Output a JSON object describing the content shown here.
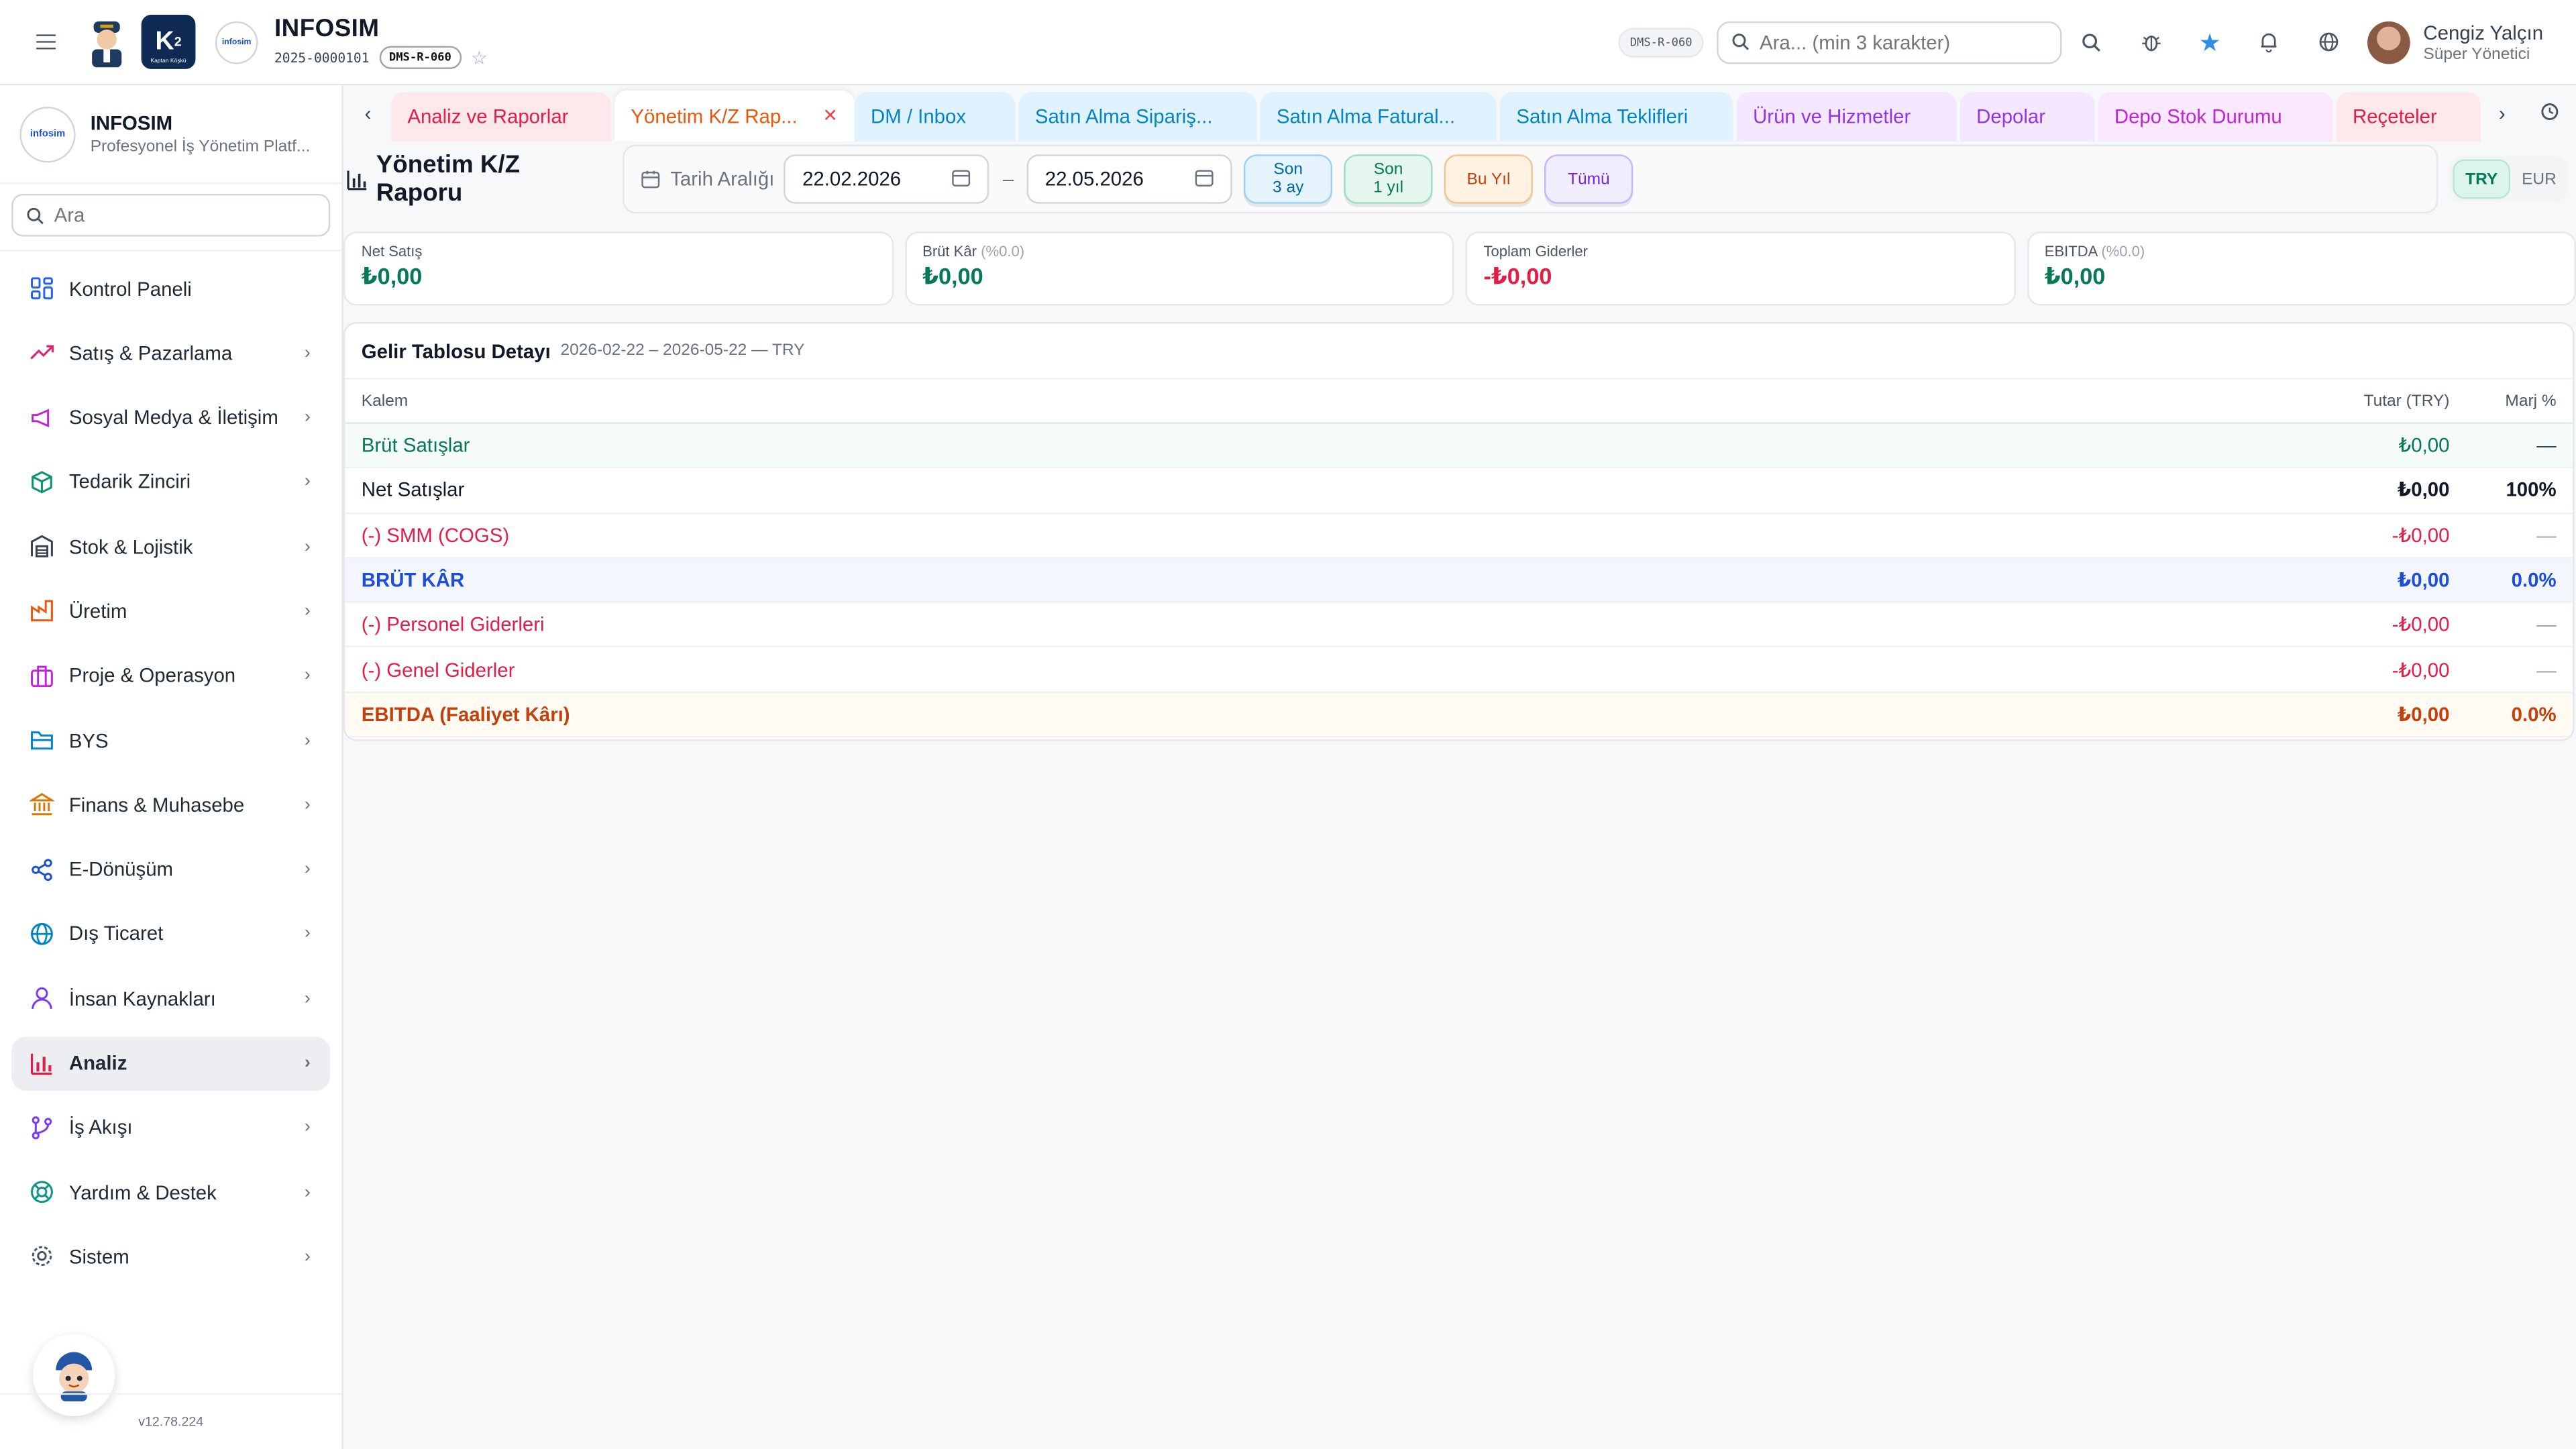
{
  "header": {
    "company_name": "INFOSIM",
    "company_code": "2025-0000101",
    "screen_code": "DMS-R-060",
    "screen_code_badge": "DMS-R-060",
    "k2_text": "K",
    "k2_sup": "2",
    "k2_sub": "Kaptan Köşkü",
    "logo_text": "infosim",
    "search_placeholder": "Ara... (min 3 karakter)",
    "user_name": "Cengiz Yalçın",
    "user_role": "Süper Yönetici"
  },
  "sidebar": {
    "title": "INFOSIM",
    "subtitle": "Profesyonel İş Yönetim Platf...",
    "search_placeholder": "Ara",
    "version": "v12.78.224",
    "items": [
      {
        "label": "Kontrol Paneli",
        "icon": "dashboard-icon",
        "color": "#2563eb"
      },
      {
        "label": "Satış & Pazarlama",
        "icon": "trending-up-icon",
        "color": "#db2777"
      },
      {
        "label": "Sosyal Medya & İletişim",
        "icon": "megaphone-icon",
        "color": "#c026d3"
      },
      {
        "label": "Tedarik Zinciri",
        "icon": "package-icon",
        "color": "#059669"
      },
      {
        "label": "Stok & Lojistik",
        "icon": "warehouse-icon",
        "color": "#374151"
      },
      {
        "label": "Üretim",
        "icon": "factory-icon",
        "color": "#ea580c"
      },
      {
        "label": "Proje & Operasyon",
        "icon": "briefcase-icon",
        "color": "#c026d3"
      },
      {
        "label": "BYS",
        "icon": "folder-icon",
        "color": "#0284c7"
      },
      {
        "label": "Finans & Muhasebe",
        "icon": "bank-icon",
        "color": "#d97706"
      },
      {
        "label": "E-Dönüşüm",
        "icon": "share-icon",
        "color": "#1d4ed8"
      },
      {
        "label": "Dış Ticaret",
        "icon": "globe-icon",
        "color": "#0284c7"
      },
      {
        "label": "İnsan Kaynakları",
        "icon": "user-icon",
        "color": "#7c3aed"
      },
      {
        "label": "Analiz",
        "icon": "bar-chart-icon",
        "color": "#e11d48"
      },
      {
        "label": "İş Akışı",
        "icon": "git-branch-icon",
        "color": "#7c3aed"
      },
      {
        "label": "Yardım & Destek",
        "icon": "lifebuoy-icon",
        "color": "#0d9488"
      },
      {
        "label": "Sistem",
        "icon": "gear-icon",
        "color": "#4b5563"
      }
    ]
  },
  "tabs": [
    {
      "label": "Analiz ve Raporlar",
      "bg": "#fde8ec",
      "color": "#e11d48"
    },
    {
      "label": "Yönetim K/Z Rap...",
      "bg": "#ffffff",
      "color": "#ea580c"
    },
    {
      "label": "DM / Inbox",
      "bg": "#e0f2fe",
      "color": "#0284c7"
    },
    {
      "label": "Satın Alma Sipariş...",
      "bg": "#e0f2fe",
      "color": "#0284c7"
    },
    {
      "label": "Satın Alma Fatural...",
      "bg": "#e0f2fe",
      "color": "#0284c7"
    },
    {
      "label": "Satın Alma Teklifleri",
      "bg": "#e0f2fe",
      "color": "#0284c7"
    },
    {
      "label": "Ürün ve Hizmetler",
      "bg": "#f3e8ff",
      "color": "#9333ea"
    },
    {
      "label": "Depolar",
      "bg": "#f3e8ff",
      "color": "#9333ea"
    },
    {
      "label": "Depo Stok Durumu",
      "bg": "#fae8ff",
      "color": "#c026d3"
    },
    {
      "label": "Reçeteler",
      "bg": "#fde8ec",
      "color": "#e11d48"
    }
  ],
  "page": {
    "title": "Yönetim K/Z Raporu",
    "date_range_label": "Tarih Aralığı",
    "date_from": "22.02.2026",
    "date_sep": "–",
    "date_to": "22.05.2026",
    "quick": [
      {
        "label": "Son\n3 ay"
      },
      {
        "label": "Son\n1 yıl"
      },
      {
        "label": "Bu Yıl"
      },
      {
        "label": "Tümü"
      }
    ],
    "currency": {
      "on": "TRY",
      "off": "EUR"
    }
  },
  "kpis": [
    {
      "label": "Net Satış",
      "suffix": "",
      "value": "₺0,00",
      "color": "#047857"
    },
    {
      "label": "Brüt Kâr",
      "suffix": "(%0.0)",
      "value": "₺0,00",
      "color": "#047857"
    },
    {
      "label": "Toplam Giderler",
      "suffix": "",
      "value": "-₺0,00",
      "color": "#e11d48"
    },
    {
      "label": "EBITDA",
      "suffix": "(%0.0)",
      "value": "₺0,00",
      "color": "#047857"
    }
  ],
  "income": {
    "title": "Gelir Tablosu Detayı",
    "subtitle": "2026-02-22 – 2026-05-22 — TRY",
    "col_item": "Kalem",
    "col_amount": "Tutar (TRY)",
    "col_margin": "Marj %",
    "rows": [
      {
        "item": "Brüt Satışlar",
        "amount": "₺0,00",
        "margin": "—",
        "color": "#047857",
        "bold": false,
        "bg": "#f4fbf8",
        "amount_color": "#047857",
        "margin_color": "#374151"
      },
      {
        "item": "Net Satışlar",
        "amount": "₺0,00",
        "margin": "100%",
        "color": "#111827",
        "bold": false,
        "bg": "#ffffff",
        "amount_color": "#111827",
        "margin_color": "#111827"
      },
      {
        "item": "(-) SMM (COGS)",
        "amount": "-₺0,00",
        "margin": "—",
        "color": "#e11d48",
        "bold": false,
        "bg": "#ffffff",
        "amount_color": "#e11d48",
        "margin_color": "#9ca3af"
      },
      {
        "item": "BRÜT KÂR",
        "amount": "₺0,00",
        "margin": "0.0%",
        "color": "#1d4ed8",
        "bold": true,
        "bg": "#f3f7fd",
        "amount_color": "#1d4ed8",
        "margin_color": "#1d4ed8"
      },
      {
        "item": "(-) Personel Giderleri",
        "amount": "-₺0,00",
        "margin": "—",
        "color": "#e11d48",
        "bold": false,
        "bg": "#ffffff",
        "amount_color": "#e11d48",
        "margin_color": "#9ca3af"
      },
      {
        "item": "(-) Genel Giderler",
        "amount": "-₺0,00",
        "margin": "—",
        "color": "#e11d48",
        "bold": false,
        "bg": "#ffffff",
        "amount_color": "#e11d48",
        "margin_color": "#9ca3af"
      },
      {
        "item": "EBITDA (Faaliyet Kârı)",
        "amount": "₺0,00",
        "margin": "0.0%",
        "color": "#c2410c",
        "bold": true,
        "bg": "#fffbf3",
        "amount_color": "#c2410c",
        "margin_color": "#c2410c"
      }
    ]
  }
}
